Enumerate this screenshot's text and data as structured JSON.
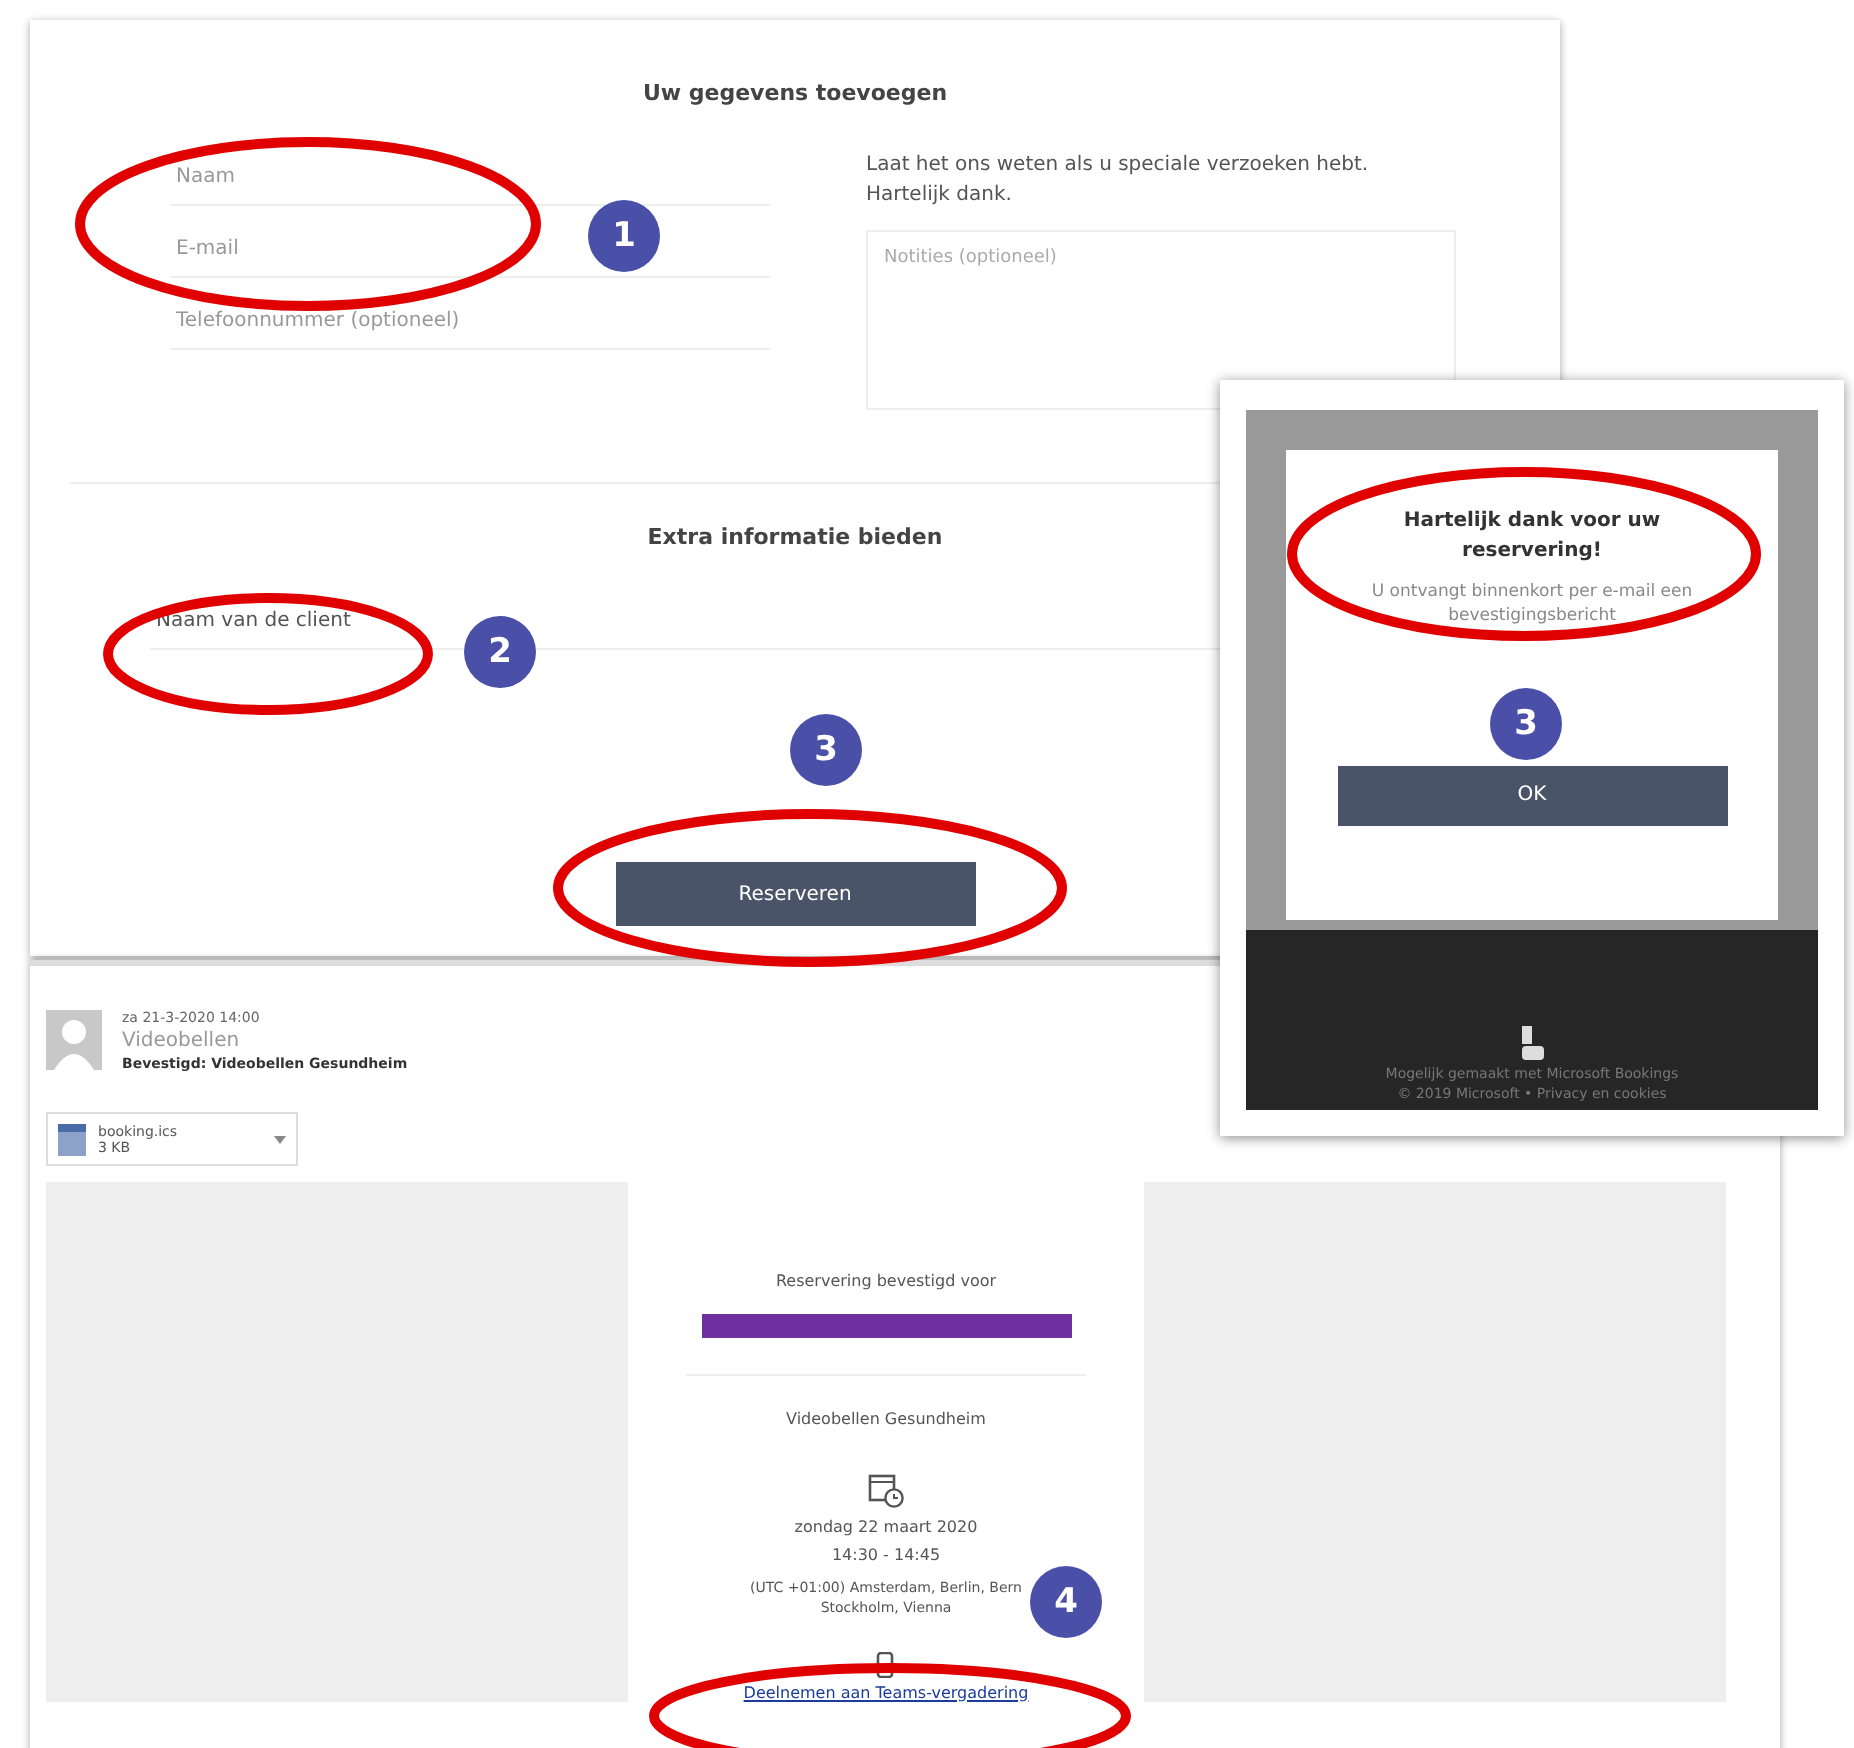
{
  "booking_form": {
    "title": "Uw gegevens toevoegen",
    "fields": [
      {
        "placeholder": "Naam"
      },
      {
        "placeholder": "E-mail"
      },
      {
        "placeholder": "Telefoonnummer (optioneel)"
      }
    ],
    "notes_intro": "Laat het ons weten als u speciale verzoeken hebt. Hartelijk dank.",
    "notes": {
      "placeholder": "Notities (optioneel)"
    },
    "extra_title": "Extra informatie bieden",
    "extra_field": {
      "placeholder": "Naam van de client"
    },
    "submit": "Reserveren"
  },
  "confirmation_dialog": {
    "title": "Hartelijk dank voor uw reservering!",
    "message": "U ontvangt binnenkort per e-mail een bevestigingsbericht",
    "ok": "OK",
    "footer": [
      "Mogelijk gemaakt met Microsoft Bookings",
      "© 2019 Microsoft  •  Privacy en cookies"
    ]
  },
  "email": {
    "date": "za 21-3-2020 14:00",
    "sender": "Videobellen",
    "subject": "Bevestigd: Videobellen Gesundheim",
    "attachment": {
      "name": "booking.ics",
      "size": "3 KB"
    },
    "card": {
      "heading": "Reservering bevestigd voor",
      "service": "Videobellen Gesundheim",
      "date": "zondag 22 maart 2020",
      "time": "14:30 - 14:45",
      "timezone": "(UTC +01:00) Amsterdam, Berlin, Bern Stockholm, Vienna",
      "link": "Deelnemen aan Teams-vergadering"
    }
  },
  "badges": [
    "1",
    "2",
    "3",
    "3",
    "4"
  ]
}
